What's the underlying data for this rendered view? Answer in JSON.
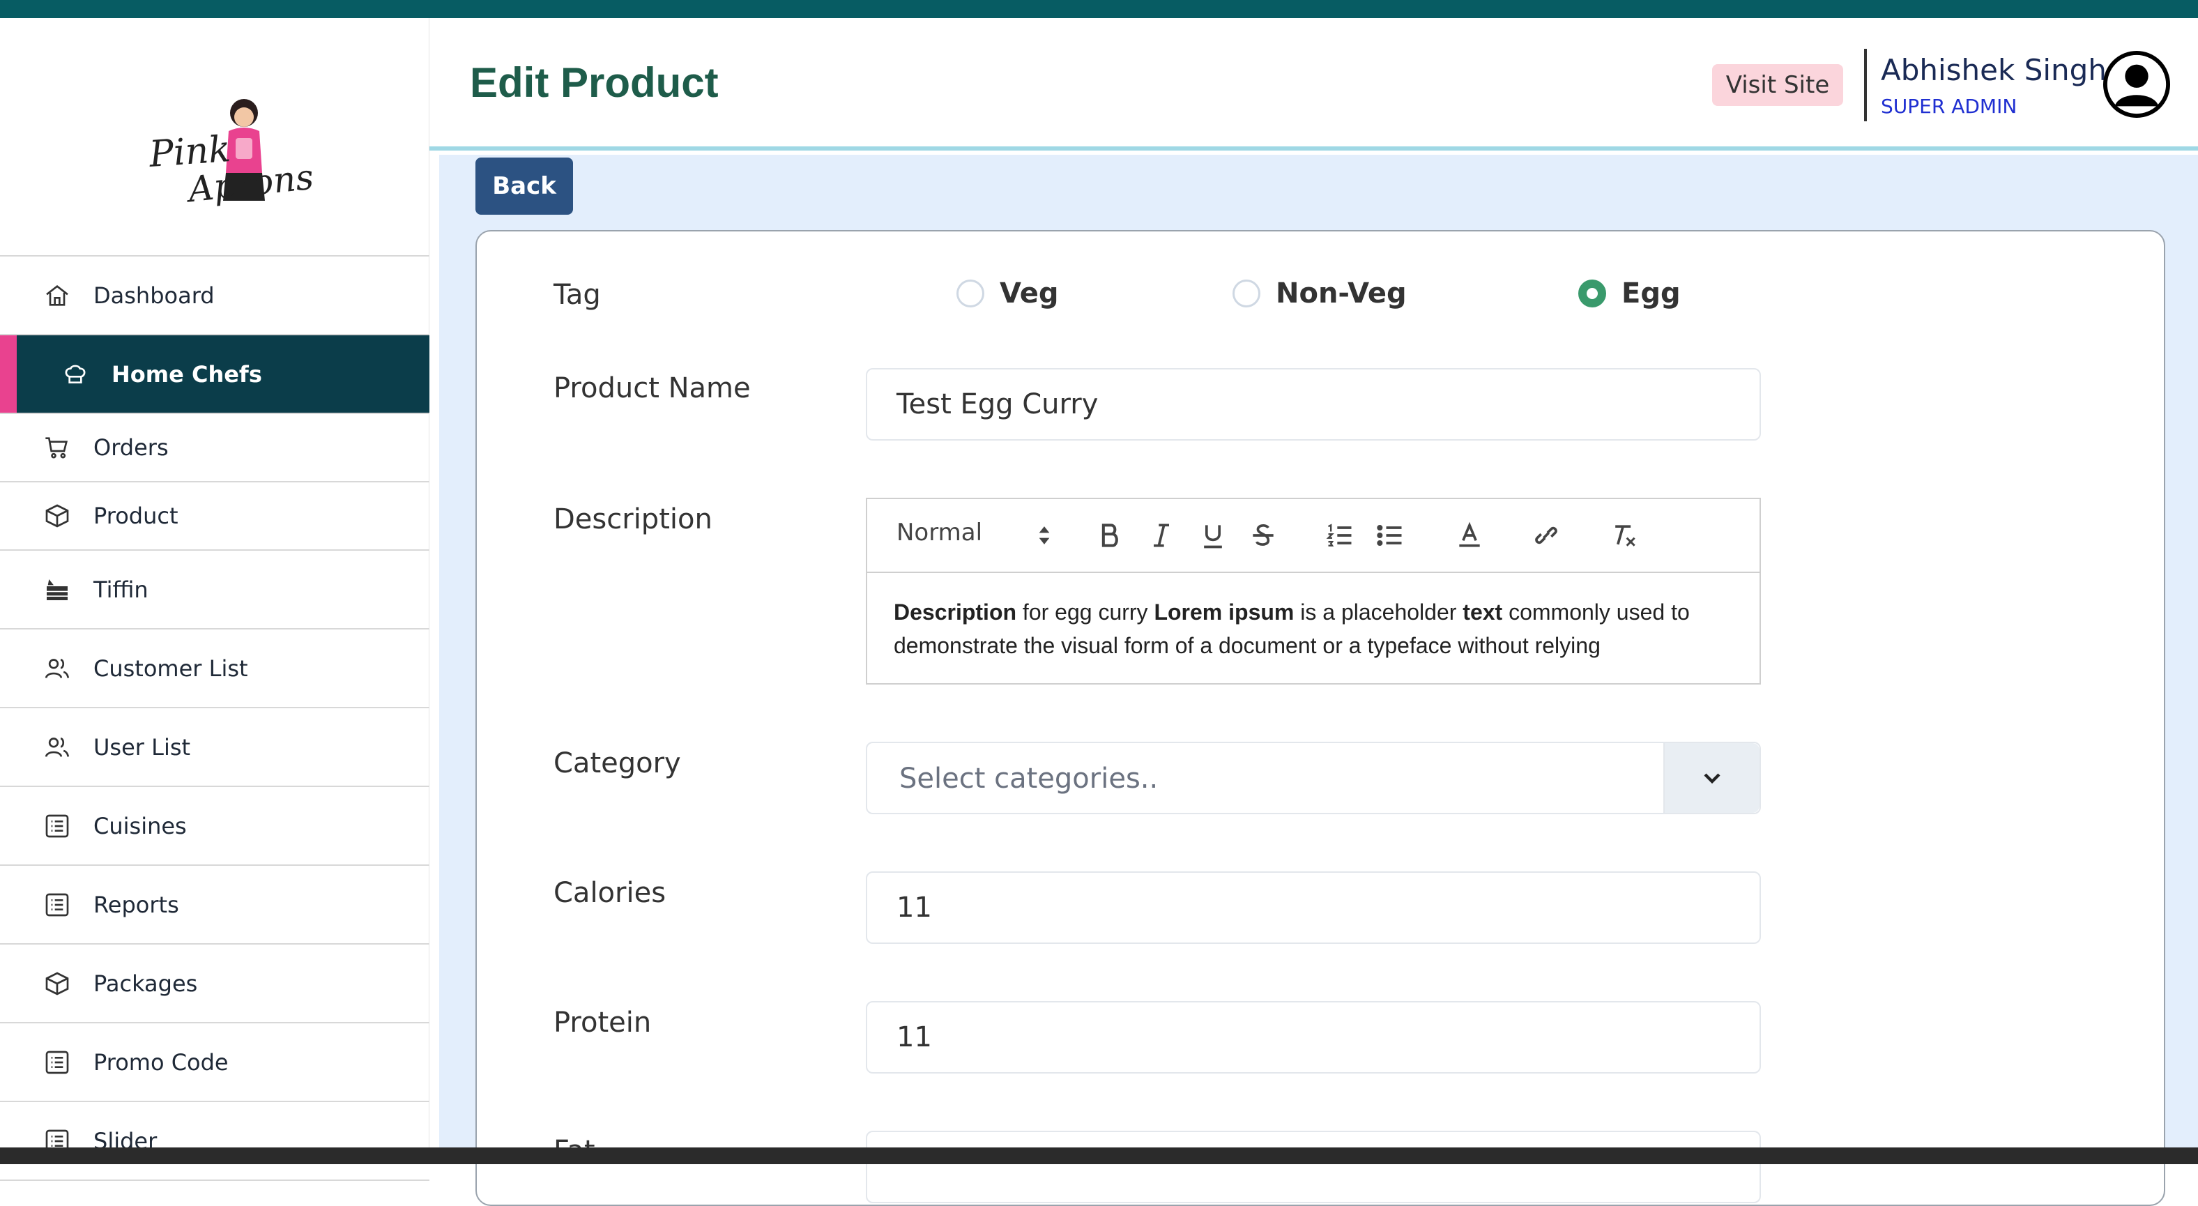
{
  "brand": {
    "logo_line1": "Pink",
    "logo_line2": "Aprons"
  },
  "sidebar": {
    "items": [
      {
        "label": "Dashboard",
        "icon": "home-icon"
      },
      {
        "label": "Home Chefs",
        "icon": "chef-hat-icon",
        "active": true
      },
      {
        "label": "Orders",
        "icon": "cart-icon"
      },
      {
        "label": "Product",
        "icon": "box-icon"
      },
      {
        "label": "Tiffin",
        "icon": "tiffin-icon"
      },
      {
        "label": "Customer List",
        "icon": "users-icon"
      },
      {
        "label": "User List",
        "icon": "users-icon"
      },
      {
        "label": "Cuisines",
        "icon": "list-icon"
      },
      {
        "label": "Reports",
        "icon": "list-icon"
      },
      {
        "label": "Packages",
        "icon": "box-icon"
      },
      {
        "label": "Promo Code",
        "icon": "list-icon"
      },
      {
        "label": "Slider",
        "icon": "list-icon"
      }
    ]
  },
  "header": {
    "title": "Edit Product",
    "visit_site": "Visit Site",
    "user_name": "Abhishek Singh",
    "user_role": "SUPER ADMIN"
  },
  "actions": {
    "back": "Back"
  },
  "form": {
    "tag_label": "Tag",
    "tag_options": [
      "Veg",
      "Non-Veg",
      "Egg"
    ],
    "tag_selected": "Egg",
    "product_name_label": "Product Name",
    "product_name_value": "Test Egg Curry",
    "description_label": "Description",
    "editor_format": "Normal",
    "description_parts": {
      "b1": "Description",
      "t1": " for egg curry ",
      "b2": "Lorem ipsum",
      "t2": " is a placeholder ",
      "b3": "text",
      "t3": " commonly used to demonstrate the visual form of a document or a typeface without relying"
    },
    "category_label": "Category",
    "category_placeholder": "Select categories..",
    "calories_label": "Calories",
    "calories_value": "11",
    "protein_label": "Protein",
    "protein_value": "11",
    "next_label_partial": "Fat"
  },
  "colors": {
    "topbar": "#075c63",
    "sidebar_active": "#0b3d4a",
    "sidebar_active_accent": "#e9428f",
    "title": "#1e5c4a",
    "back_button": "#2c5282",
    "radio_checked": "#3a9a6c"
  }
}
